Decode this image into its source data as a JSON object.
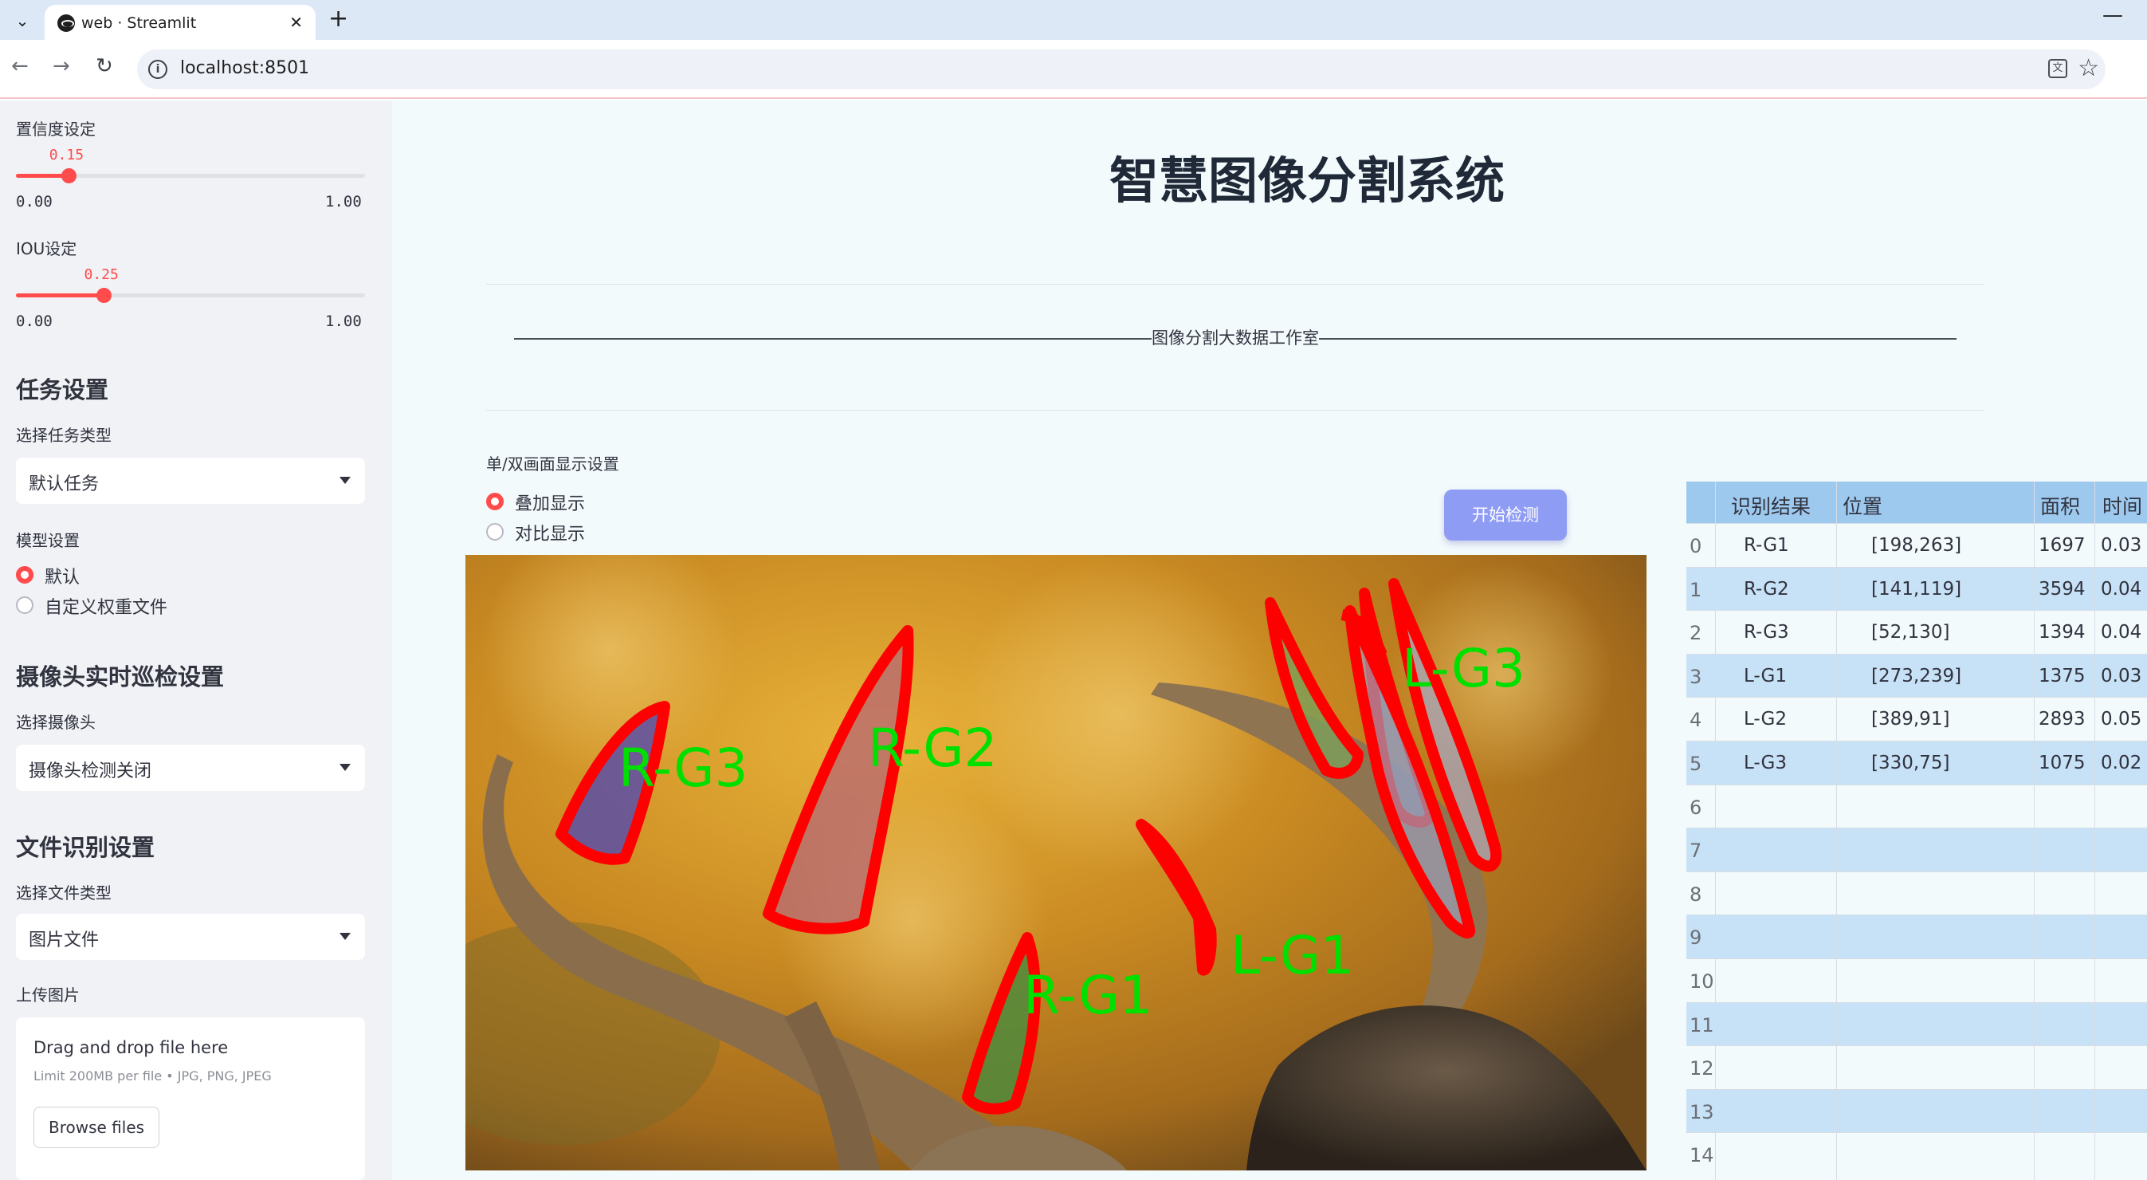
{
  "browser": {
    "tab_title": "web · Streamlit",
    "url": "localhost:8501"
  },
  "sidebar": {
    "confidence": {
      "label": "置信度设定",
      "value": "0.15",
      "value_fraction": 0.15,
      "min": "0.00",
      "max": "1.00"
    },
    "iou": {
      "label": "IOU设定",
      "value": "0.25",
      "value_fraction": 0.25,
      "min": "0.00",
      "max": "1.00"
    },
    "task": {
      "heading": "任务设置",
      "select_label": "选择任务类型",
      "selected": "默认任务"
    },
    "model": {
      "label": "模型设置",
      "options": [
        "默认",
        "自定义权重文件"
      ],
      "selected_index": 0
    },
    "camera": {
      "heading": "摄像头实时巡检设置",
      "select_label": "选择摄像头",
      "selected": "摄像头检测关闭"
    },
    "file": {
      "heading": "文件识别设置",
      "select_label": "选择文件类型",
      "selected": "图片文件",
      "upload_label": "上传图片",
      "drop_title": "Drag and drop file here",
      "drop_sub": "Limit 200MB per file • JPG, PNG, JPEG",
      "browse_label": "Browse files"
    }
  },
  "main": {
    "title": "智慧图像分割系统",
    "divider_text": "图像分割大数据工作室",
    "display_mode": {
      "label": "单/双画面显示设置",
      "options": [
        "叠加显示",
        "对比显示"
      ],
      "selected_index": 0
    },
    "start_button": "开始检测",
    "detections": [
      "R-G3",
      "R-G2",
      "R-G1",
      "L-G1",
      "L-G3"
    ],
    "colors": {
      "mask_outline": "#ff0000",
      "label_text": "#00e000",
      "accent": "#ff4b4b",
      "button": "#8f9cf4",
      "table_header": "#9ec9ee"
    }
  },
  "table": {
    "headers": [
      "识别结果",
      "位置",
      "面积",
      "时间"
    ],
    "rows": [
      {
        "index": "0",
        "result": "R-G1",
        "position": "[198,263]",
        "area": "1697",
        "time": "0.03"
      },
      {
        "index": "1",
        "result": "R-G2",
        "position": "[141,119]",
        "area": "3594",
        "time": "0.04"
      },
      {
        "index": "2",
        "result": "R-G3",
        "position": "[52,130]",
        "area": "1394",
        "time": "0.04"
      },
      {
        "index": "3",
        "result": "L-G1",
        "position": "[273,239]",
        "area": "1375",
        "time": "0.03"
      },
      {
        "index": "4",
        "result": "L-G2",
        "position": "[389,91]",
        "area": "2893",
        "time": "0.05"
      },
      {
        "index": "5",
        "result": "L-G3",
        "position": "[330,75]",
        "area": "1075",
        "time": "0.02"
      },
      {
        "index": "6",
        "result": "",
        "position": "",
        "area": "",
        "time": ""
      },
      {
        "index": "7",
        "result": "",
        "position": "",
        "area": "",
        "time": ""
      },
      {
        "index": "8",
        "result": "",
        "position": "",
        "area": "",
        "time": ""
      },
      {
        "index": "9",
        "result": "",
        "position": "",
        "area": "",
        "time": ""
      },
      {
        "index": "10",
        "result": "",
        "position": "",
        "area": "",
        "time": ""
      },
      {
        "index": "11",
        "result": "",
        "position": "",
        "area": "",
        "time": ""
      },
      {
        "index": "12",
        "result": "",
        "position": "",
        "area": "",
        "time": ""
      },
      {
        "index": "13",
        "result": "",
        "position": "",
        "area": "",
        "time": ""
      },
      {
        "index": "14",
        "result": "",
        "position": "",
        "area": "",
        "time": ""
      }
    ]
  }
}
